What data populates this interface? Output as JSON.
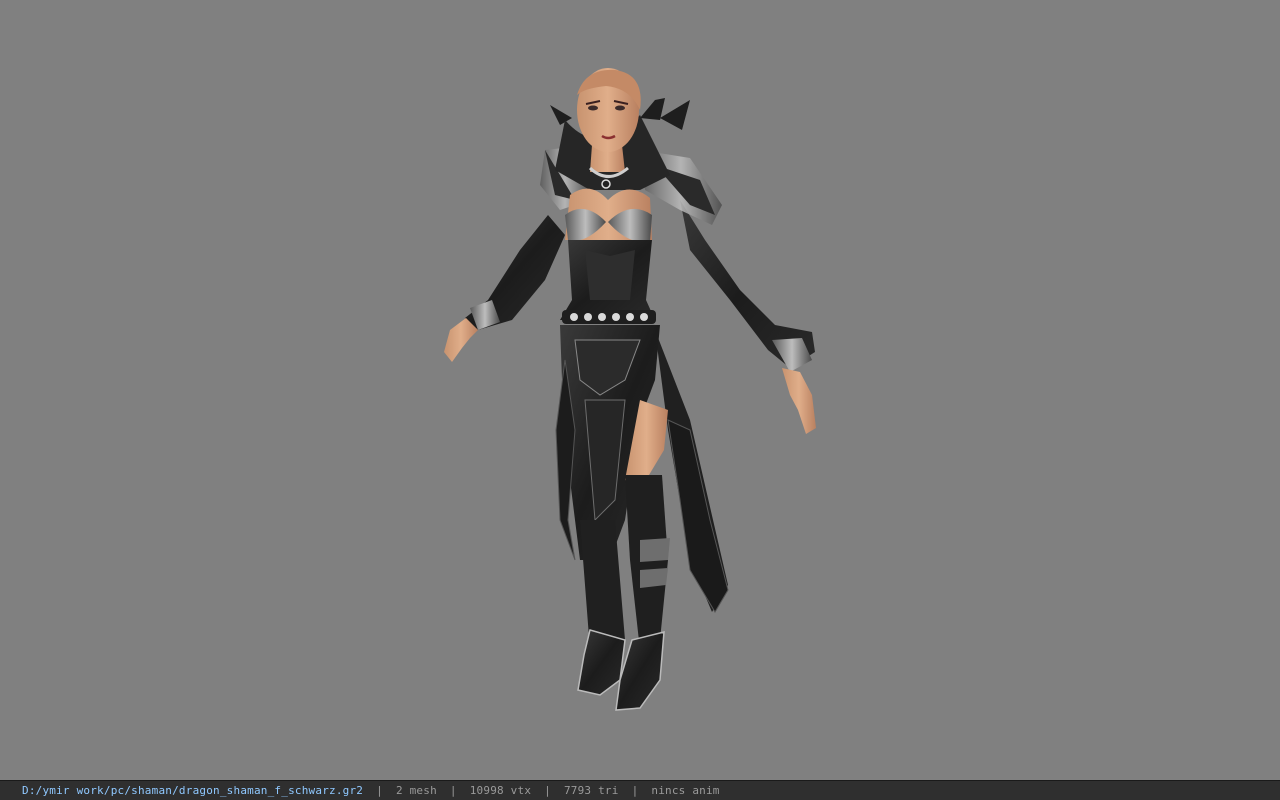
{
  "viewer": {
    "background_color": "#808080",
    "model": "character-model"
  },
  "statusbar": {
    "file_path": "D:/ymir work/pc/shaman/dragon_shaman_f_schwarz.gr2",
    "separator": "|",
    "mesh_count": "2 mesh",
    "vertex_count": "10998 vtx",
    "triangle_count": "7793 tri",
    "animation": "nincs anim"
  }
}
